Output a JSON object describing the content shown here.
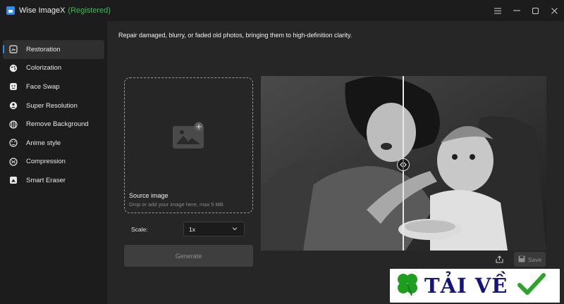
{
  "titlebar": {
    "app_name": "Wise ImageX",
    "registration": "(Registered)",
    "menu_icon": "hamburger-icon",
    "minimize_icon": "minimize-icon",
    "maximize_icon": "maximize-icon",
    "close_icon": "close-icon"
  },
  "sidebar": {
    "active_index": 0,
    "items": [
      {
        "label": "Restoration",
        "icon": "restoration-icon"
      },
      {
        "label": "Colorization",
        "icon": "palette-icon"
      },
      {
        "label": "Face Swap",
        "icon": "face-icon"
      },
      {
        "label": "Super Resolution",
        "icon": "person-badge-icon"
      },
      {
        "label": "Remove Background",
        "icon": "remove-background-icon"
      },
      {
        "label": "Anime style",
        "icon": "anime-icon"
      },
      {
        "label": "Compression",
        "icon": "compression-icon"
      },
      {
        "label": "Smart Eraser",
        "icon": "eraser-icon"
      }
    ]
  },
  "main": {
    "description": "Repair damaged, blurry, or faded old photos, bringing them to high-definition clarity.",
    "dropzone": {
      "title": "Source image",
      "hint": "Drop or add your image here, max 5 MB.",
      "icon": "add-image-icon"
    },
    "scale": {
      "label": "Scale:",
      "value": "1x"
    },
    "generate_label": "Generate",
    "preview": {
      "divider_fraction": 0.5
    },
    "save_label": "Save",
    "share_icon": "share-icon"
  },
  "watermark": {
    "text": "TẢI VỀ"
  },
  "colors": {
    "accent": "#2f8cf0",
    "registered": "#3cbc55",
    "background": "#262626",
    "sidebar": "#1c1c1c"
  }
}
